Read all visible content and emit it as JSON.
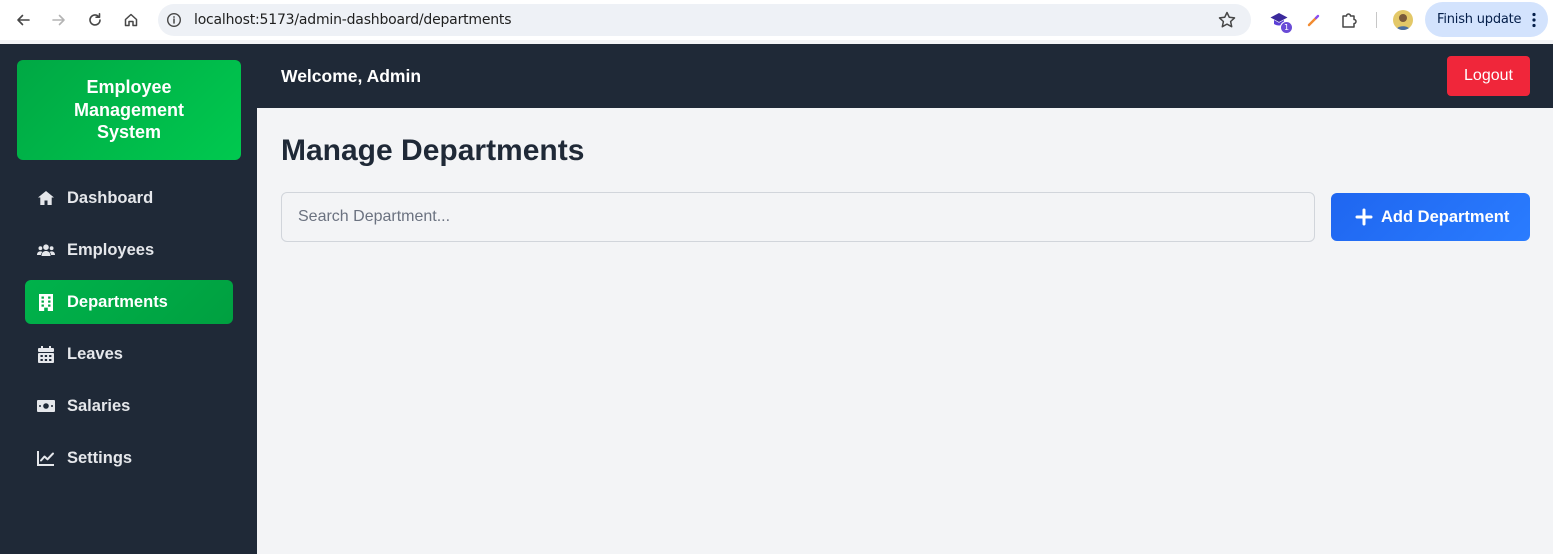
{
  "browser": {
    "url": "localhost:5173/admin-dashboard/departments",
    "extension_badge": "1",
    "finish_update_label": "Finish update"
  },
  "sidebar": {
    "brand": "Employee Management System",
    "items": [
      {
        "label": "Dashboard",
        "icon": "home-icon",
        "active": false
      },
      {
        "label": "Employees",
        "icon": "users-icon",
        "active": false
      },
      {
        "label": "Departments",
        "icon": "building-icon",
        "active": true
      },
      {
        "label": "Leaves",
        "icon": "calendar-icon",
        "active": false
      },
      {
        "label": "Salaries",
        "icon": "money-bill-icon",
        "active": false
      },
      {
        "label": "Settings",
        "icon": "chart-line-icon",
        "active": false
      }
    ]
  },
  "header": {
    "welcome": "Welcome, Admin",
    "logout_label": "Logout"
  },
  "main": {
    "title": "Manage Departments",
    "search_placeholder": "Search Department...",
    "search_value": "",
    "add_button_label": "Add Department"
  },
  "colors": {
    "sidebar_bg": "#1f2937",
    "brand_green": "#00b24b",
    "logout_red": "#f0263a",
    "add_blue": "#1f66f0"
  }
}
